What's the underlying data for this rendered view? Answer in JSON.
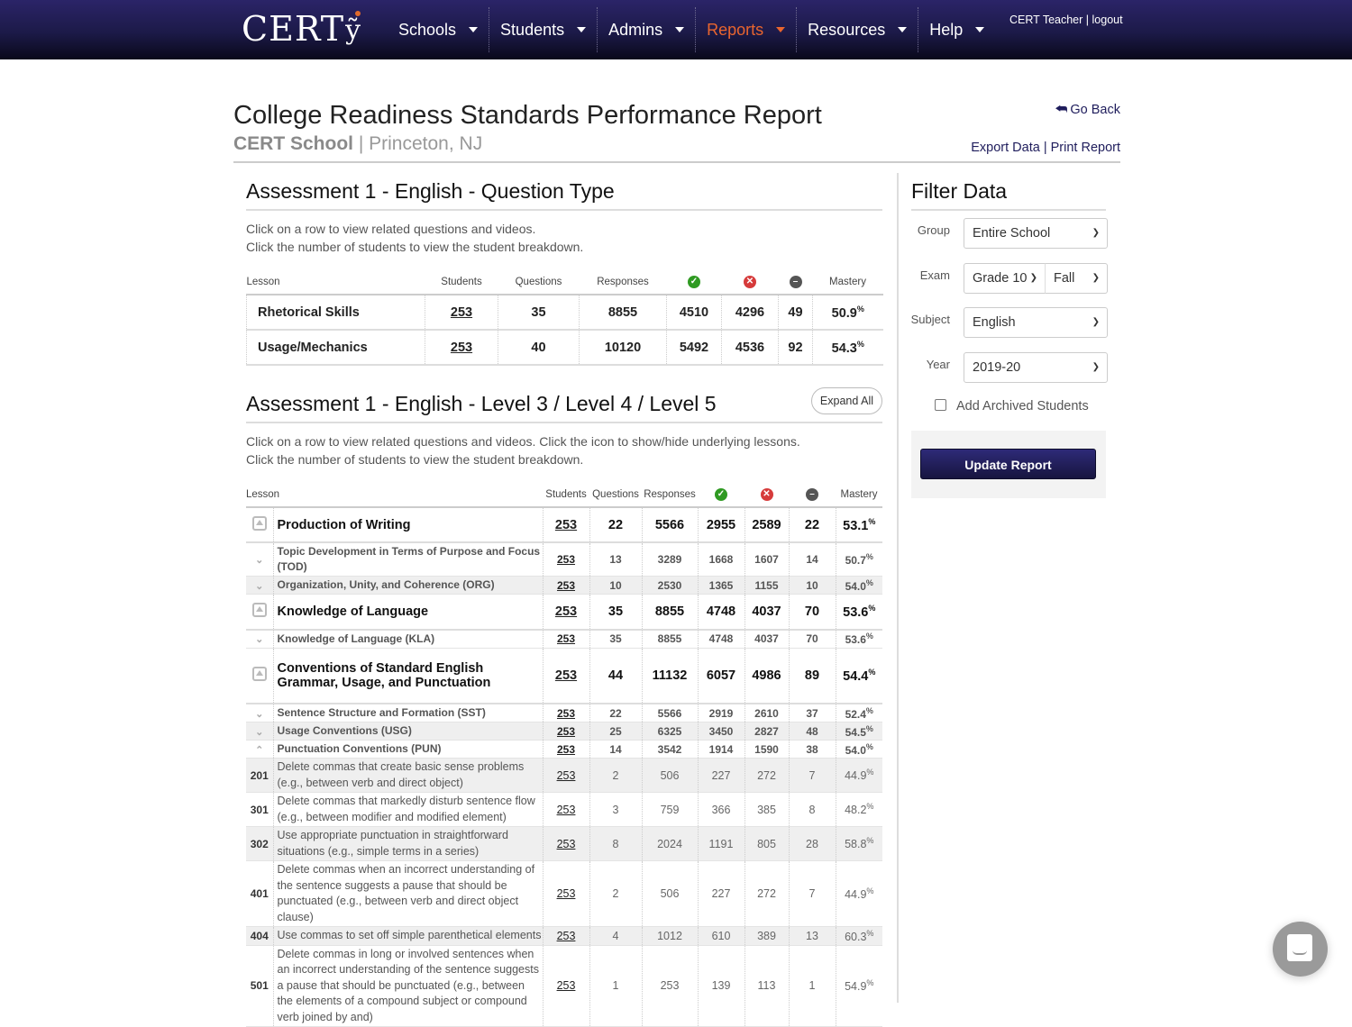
{
  "brand": {
    "logo_text": "CERT"
  },
  "nav": {
    "items": [
      {
        "label": "Schools",
        "active": false
      },
      {
        "label": "Students",
        "active": false
      },
      {
        "label": "Admins",
        "active": false
      },
      {
        "label": "Reports",
        "active": true
      },
      {
        "label": "Resources",
        "active": false
      },
      {
        "label": "Help",
        "active": false
      }
    ],
    "accent_color": "#e9652e",
    "user_name": "CERT Teacher",
    "separator": "|",
    "logout_label": "logout"
  },
  "header": {
    "title": "College Readiness Standards Performance Report",
    "school": "CERT School",
    "location": "Princeton, NJ",
    "go_back": "Go Back",
    "export_data": "Export Data",
    "print_report": "Print Report"
  },
  "section1": {
    "title": "Assessment 1 - English - Question Type",
    "instructions": [
      "Click on a row to view related questions and videos.",
      "Click the number of students to view the student breakdown."
    ],
    "columns": {
      "lesson": "Lesson",
      "students": "Students",
      "questions": "Questions",
      "responses": "Responses",
      "correct_icon": "check-circle",
      "incorrect_icon": "x-circle",
      "omitted_icon": "minus-circle",
      "mastery": "Mastery"
    },
    "rows": [
      {
        "lesson": "Rhetorical Skills",
        "students": "253",
        "questions": "35",
        "responses": "8855",
        "correct": "4510",
        "incorrect": "4296",
        "omitted": "49",
        "mastery": "50.9"
      },
      {
        "lesson": "Usage/Mechanics",
        "students": "253",
        "questions": "40",
        "responses": "10120",
        "correct": "5492",
        "incorrect": "4536",
        "omitted": "92",
        "mastery": "54.3"
      }
    ]
  },
  "section2": {
    "title": "Assessment 1 - English - Level 3 / Level 4 / Level 5",
    "expand_all": "Expand All",
    "instructions": [
      "Click on a row to view related questions and videos. Click the icon to show/hide underlying lessons.",
      "Click the number of students to view the student breakdown."
    ],
    "columns": {
      "lesson": "Lesson",
      "students": "Students",
      "questions": "Questions",
      "responses": "Responses",
      "mastery": "Mastery"
    },
    "rows": [
      {
        "level": 1,
        "lesson": "Production of Writing",
        "students": "253",
        "questions": "22",
        "responses": "5566",
        "correct": "2955",
        "incorrect": "2589",
        "omitted": "22",
        "mastery": "53.1"
      },
      {
        "level": 2,
        "lesson": "Topic Development in Terms of Purpose and Focus (TOD)",
        "students": "253",
        "questions": "13",
        "responses": "3289",
        "correct": "1668",
        "incorrect": "1607",
        "omitted": "14",
        "mastery": "50.7"
      },
      {
        "level": 2,
        "lesson": "Organization, Unity, and Coherence (ORG)",
        "students": "253",
        "questions": "10",
        "responses": "2530",
        "correct": "1365",
        "incorrect": "1155",
        "omitted": "10",
        "mastery": "54.0"
      },
      {
        "level": 1,
        "lesson": "Knowledge of Language",
        "students": "253",
        "questions": "35",
        "responses": "8855",
        "correct": "4748",
        "incorrect": "4037",
        "omitted": "70",
        "mastery": "53.6"
      },
      {
        "level": 2,
        "lesson": "Knowledge of Language (KLA)",
        "students": "253",
        "questions": "35",
        "responses": "8855",
        "correct": "4748",
        "incorrect": "4037",
        "omitted": "70",
        "mastery": "53.6"
      },
      {
        "level": 1,
        "lesson": "Conventions of Standard English Grammar, Usage, and Punctuation",
        "students": "253",
        "questions": "44",
        "responses": "11132",
        "correct": "6057",
        "incorrect": "4986",
        "omitted": "89",
        "mastery": "54.4"
      },
      {
        "level": 2,
        "lesson": "Sentence Structure and Formation (SST)",
        "students": "253",
        "questions": "22",
        "responses": "5566",
        "correct": "2919",
        "incorrect": "2610",
        "omitted": "37",
        "mastery": "52.4"
      },
      {
        "level": 2,
        "lesson": "Usage Conventions (USG)",
        "students": "253",
        "questions": "25",
        "responses": "6325",
        "correct": "3450",
        "incorrect": "2827",
        "omitted": "48",
        "mastery": "54.5"
      },
      {
        "level": 2,
        "expanded": true,
        "lesson": "Punctuation Conventions (PUN)",
        "students": "253",
        "questions": "14",
        "responses": "3542",
        "correct": "1914",
        "incorrect": "1590",
        "omitted": "38",
        "mastery": "54.0"
      },
      {
        "level": 3,
        "code": "201",
        "lesson": "Delete commas that create basic sense problems (e.g., between verb and direct object)",
        "students": "253",
        "questions": "2",
        "responses": "506",
        "correct": "227",
        "incorrect": "272",
        "omitted": "7",
        "mastery": "44.9"
      },
      {
        "level": 3,
        "code": "301",
        "lesson": "Delete commas that markedly disturb sentence flow (e.g., between modifier and modified element)",
        "students": "253",
        "questions": "3",
        "responses": "759",
        "correct": "366",
        "incorrect": "385",
        "omitted": "8",
        "mastery": "48.2"
      },
      {
        "level": 3,
        "code": "302",
        "lesson": "Use appropriate punctuation in straightforward situations (e.g., simple terms in a series)",
        "students": "253",
        "questions": "8",
        "responses": "2024",
        "correct": "1191",
        "incorrect": "805",
        "omitted": "28",
        "mastery": "58.8"
      },
      {
        "level": 3,
        "code": "401",
        "lesson": "Delete commas when an incorrect understanding of the sentence suggests a pause that should be punctuated (e.g., between verb and direct object clause)",
        "students": "253",
        "questions": "2",
        "responses": "506",
        "correct": "227",
        "incorrect": "272",
        "omitted": "7",
        "mastery": "44.9"
      },
      {
        "level": 3,
        "code": "404",
        "lesson": "Use commas to set off simple parenthetical elements",
        "students": "253",
        "questions": "4",
        "responses": "1012",
        "correct": "610",
        "incorrect": "389",
        "omitted": "13",
        "mastery": "60.3"
      },
      {
        "level": 3,
        "code": "501",
        "lesson": "Delete commas in long or involved sentences when an incorrect understanding of the sentence suggests a pause that should be punctuated (e.g., between the elements of a compound subject or compound verb joined by and)",
        "students": "253",
        "questions": "1",
        "responses": "253",
        "correct": "139",
        "incorrect": "113",
        "omitted": "1",
        "mastery": "54.9"
      }
    ]
  },
  "percent_sign": "%",
  "filter": {
    "title": "Filter Data",
    "group_label": "Group",
    "group_value": "Entire School",
    "exam_label": "Exam",
    "exam_grade": "Grade 10",
    "exam_season": "Fall",
    "subject_label": "Subject",
    "subject_value": "English",
    "year_label": "Year",
    "year_value": "2019-20",
    "archived_label": "Add Archived Students",
    "archived_checked": false,
    "update_button": "Update Report"
  }
}
